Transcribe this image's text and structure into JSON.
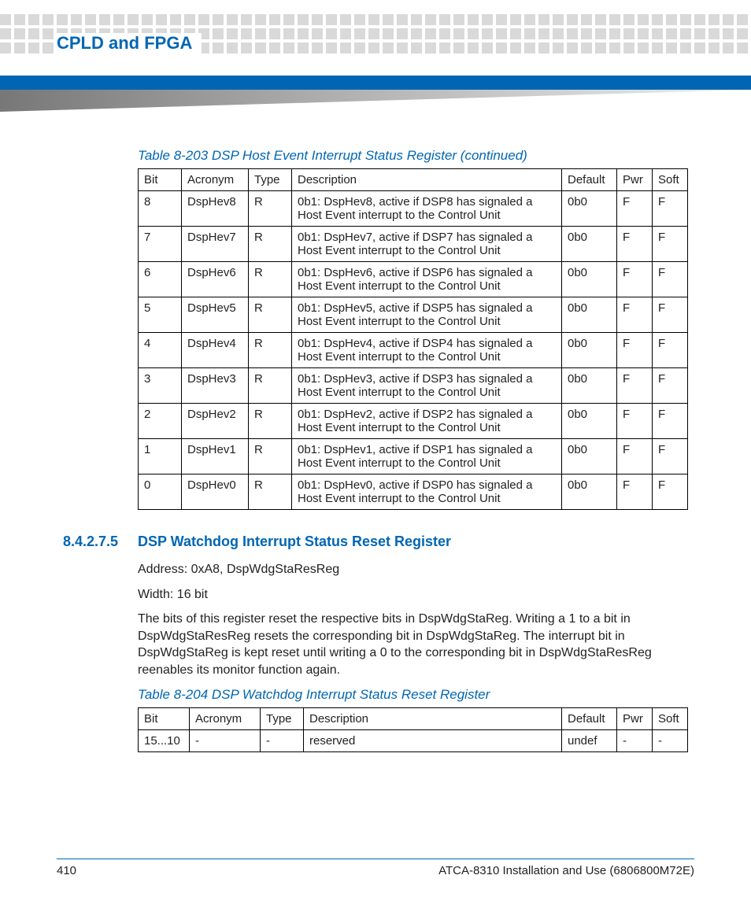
{
  "header": {
    "chapter_title": "CPLD and FPGA"
  },
  "table1": {
    "caption": "Table 8-203 DSP Host Event Interrupt Status Register (continued)",
    "headers": [
      "Bit",
      "Acronym",
      "Type",
      "Description",
      "Default",
      "Pwr",
      "Soft"
    ],
    "rows": [
      {
        "bit": "8",
        "acr": "DspHev8",
        "type": "R",
        "desc": "0b1: DspHev8, active if DSP8 has signaled a Host Event interrupt to the Control Unit",
        "def": "0b0",
        "pwr": "F",
        "soft": "F"
      },
      {
        "bit": "7",
        "acr": "DspHev7",
        "type": "R",
        "desc": "0b1: DspHev7, active if DSP7 has signaled a Host Event interrupt to the Control Unit",
        "def": "0b0",
        "pwr": "F",
        "soft": "F"
      },
      {
        "bit": "6",
        "acr": "DspHev6",
        "type": "R",
        "desc": "0b1: DspHev6, active if DSP6 has signaled a Host Event interrupt to the Control Unit",
        "def": "0b0",
        "pwr": "F",
        "soft": "F"
      },
      {
        "bit": "5",
        "acr": "DspHev5",
        "type": "R",
        "desc": "0b1: DspHev5, active if DSP5 has signaled a Host Event interrupt to the Control Unit",
        "def": "0b0",
        "pwr": "F",
        "soft": "F"
      },
      {
        "bit": "4",
        "acr": "DspHev4",
        "type": "R",
        "desc": "0b1: DspHev4, active if DSP4 has signaled a Host Event interrupt to the Control Unit",
        "def": "0b0",
        "pwr": "F",
        "soft": "F"
      },
      {
        "bit": "3",
        "acr": "DspHev3",
        "type": "R",
        "desc": "0b1: DspHev3, active if DSP3 has signaled a Host Event interrupt to the Control Unit",
        "def": "0b0",
        "pwr": "F",
        "soft": "F"
      },
      {
        "bit": "2",
        "acr": "DspHev2",
        "type": "R",
        "desc": "0b1: DspHev2, active if DSP2 has signaled a Host Event interrupt to the Control Unit",
        "def": "0b0",
        "pwr": "F",
        "soft": "F"
      },
      {
        "bit": "1",
        "acr": "DspHev1",
        "type": "R",
        "desc": "0b1: DspHev1, active if DSP1 has signaled a Host Event interrupt to the Control Unit",
        "def": "0b0",
        "pwr": "F",
        "soft": "F"
      },
      {
        "bit": "0",
        "acr": "DspHev0",
        "type": "R",
        "desc": "0b1: DspHev0, active if DSP0 has signaled a Host Event interrupt to the Control Unit",
        "def": "0b0",
        "pwr": "F",
        "soft": "F"
      }
    ]
  },
  "section": {
    "number": "8.4.2.7.5",
    "title": "DSP Watchdog Interrupt Status Reset Register",
    "address_line": "Address: 0xA8, DspWdgStaResReg",
    "width_line": "Width: 16 bit",
    "description": "The bits of this register reset the respective bits in DspWdgStaReg. Writing a 1 to a bit in DspWdgStaResReg resets the corresponding bit in DspWdgStaReg. The interrupt bit in DspWdgStaReg is kept reset until writing a 0 to the corresponding bit in DspWdgStaResReg reenables its monitor function again."
  },
  "table2": {
    "caption": "Table 8-204 DSP Watchdog Interrupt Status Reset Register",
    "headers": [
      "Bit",
      "Acronym",
      "Type",
      "Description",
      "Default",
      "Pwr",
      "Soft"
    ],
    "rows": [
      {
        "bit": "15...10",
        "acr": "-",
        "type": "-",
        "desc": "reserved",
        "def": "undef",
        "pwr": "-",
        "soft": "-"
      }
    ]
  },
  "footer": {
    "page_number": "410",
    "doc_title": "ATCA-8310 Installation and Use (6806800M72E)"
  }
}
